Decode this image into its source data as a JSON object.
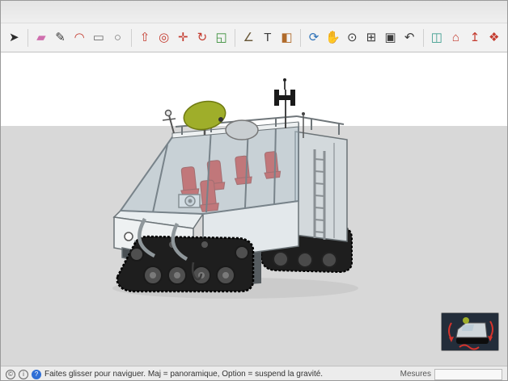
{
  "toolbar": {
    "items": [
      {
        "name": "select-tool",
        "label": "Sélectionner",
        "glyph": "➤",
        "color": "#2b2b2b"
      },
      {
        "name": "eraser-tool",
        "label": "Effacer",
        "glyph": "▰",
        "color": "#cf6fae"
      },
      {
        "name": "line-tool",
        "label": "Ligne",
        "glyph": "✎",
        "color": "#3b3b3b"
      },
      {
        "name": "arc-tool",
        "label": "Arc",
        "glyph": "◠",
        "color": "#c43b2f"
      },
      {
        "name": "rectangle-tool",
        "label": "Rectangle",
        "glyph": "▭",
        "color": "#6f6f6f"
      },
      {
        "name": "circle-tool",
        "label": "Cercle",
        "glyph": "○",
        "color": "#6f6f6f"
      },
      {
        "name": "pushpull-tool",
        "label": "Pousser/Tirer",
        "glyph": "⇧",
        "color": "#c43b2f"
      },
      {
        "name": "offset-tool",
        "label": "Décalage",
        "glyph": "◎",
        "color": "#c43b2f"
      },
      {
        "name": "move-tool",
        "label": "Déplacer",
        "glyph": "✛",
        "color": "#c43b2f"
      },
      {
        "name": "rotate-tool",
        "label": "Faire pivoter",
        "glyph": "↻",
        "color": "#c43b2f"
      },
      {
        "name": "scale-tool",
        "label": "Échelle",
        "glyph": "◱",
        "color": "#3a8f3a"
      },
      {
        "name": "tape-measure-tool",
        "label": "Mètre",
        "glyph": "∠",
        "color": "#6b5a3a"
      },
      {
        "name": "text-tool",
        "label": "Texte",
        "glyph": "T",
        "color": "#3b3b3b"
      },
      {
        "name": "paint-bucket-tool",
        "label": "Colorier",
        "glyph": "◧",
        "color": "#b06a2a"
      },
      {
        "name": "orbit-tool",
        "label": "Orbite",
        "glyph": "⟳",
        "color": "#2e72b8"
      },
      {
        "name": "pan-tool",
        "label": "Panoramique",
        "glyph": "✋",
        "color": "#c09a2e"
      },
      {
        "name": "zoom-tool",
        "label": "Zoom",
        "glyph": "⊙",
        "color": "#3b3b3b"
      },
      {
        "name": "zoom-window-tool",
        "label": "Fenêtre de zoom",
        "glyph": "⊞",
        "color": "#3b3b3b"
      },
      {
        "name": "zoom-extents-tool",
        "label": "Zoom étendu",
        "glyph": "▣",
        "color": "#3b3b3b"
      },
      {
        "name": "previous-view-tool",
        "label": "Vue précédente",
        "glyph": "↶",
        "color": "#3b3b3b"
      },
      {
        "name": "section-plane-tool",
        "label": "Plan de section",
        "glyph": "◫",
        "color": "#3f9e8f"
      },
      {
        "name": "warehouse-tool",
        "label": "3D Warehouse",
        "glyph": "⌂",
        "color": "#c43b2f"
      },
      {
        "name": "share-tool",
        "label": "Partager",
        "glyph": "↥",
        "color": "#c43b2f"
      },
      {
        "name": "components-tool",
        "label": "Composants",
        "glyph": "❖",
        "color": "#c43b2f"
      }
    ]
  },
  "canvas": {
    "sky_color": "#ffffff",
    "ground_color": "#d8d8d8"
  },
  "model": {
    "colors": {
      "body": "#eef1f2",
      "glass": "#b7c9d4",
      "seat": "#cb2420",
      "dish": "#9fae2a",
      "track": "#1e1e1e",
      "accent_red": "#d6342c"
    }
  },
  "statusbar": {
    "icons": [
      {
        "name": "attribution-icon",
        "glyph": "©"
      },
      {
        "name": "info-icon",
        "glyph": "i"
      },
      {
        "name": "help-icon",
        "glyph": "?"
      }
    ],
    "message": "Faites glisser pour naviguer. Maj = panoramique, Option =  suspend la gravité.",
    "measure_label": "Mesures",
    "measure_value": ""
  }
}
